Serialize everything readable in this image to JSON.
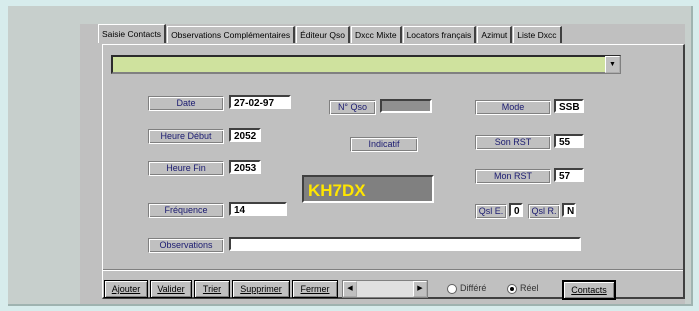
{
  "tabs": [
    {
      "label": "Saisie Contacts"
    },
    {
      "label": "Observations Complémentaires"
    },
    {
      "label": "Éditeur Qso"
    },
    {
      "label": "Dxcc Mixte"
    },
    {
      "label": "Locators français"
    },
    {
      "label": "Azimut"
    },
    {
      "label": "Liste Dxcc"
    }
  ],
  "combo": {
    "value": ""
  },
  "form": {
    "date_label": "Date",
    "date_value": "27-02-97",
    "heure_debut_label": "Heure Début",
    "heure_debut_value": "2052",
    "heure_fin_label": "Heure Fin",
    "heure_fin_value": "2053",
    "frequence_label": "Fréquence",
    "frequence_value": "14",
    "observations_label": "Observations",
    "observations_value": "",
    "nqso_label": "N° Qso",
    "nqso_value": "",
    "indicatif_label": "Indicatif",
    "indicatif_value": "KH7DX",
    "mode_label": "Mode",
    "mode_value": "SSB",
    "son_rst_label": "Son RST",
    "son_rst_value": "55",
    "mon_rst_label": "Mon RST",
    "mon_rst_value": "57",
    "qsle_label": "Qsl E.",
    "qsle_value": "0",
    "qslr_label": "Qsl R.",
    "qslr_value": "N"
  },
  "buttons": {
    "ajouter": "Ajouter",
    "valider": "Valider",
    "trier": "Trier",
    "supprimer": "Supprimer",
    "fermer": "Fermer",
    "contacts": "Contacts"
  },
  "radios": {
    "differe": "Différé",
    "reel": "Réel",
    "selected": "reel"
  }
}
